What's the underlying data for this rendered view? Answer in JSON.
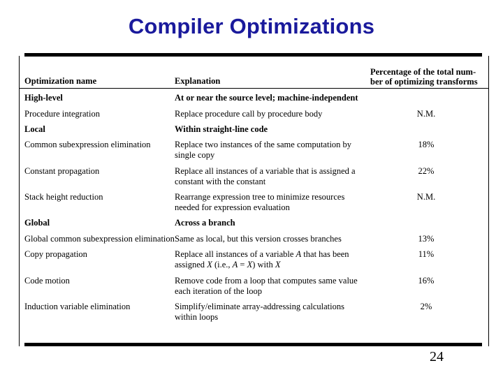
{
  "slide": {
    "title": "Compiler Optimizations",
    "number": "24",
    "title_color": "#1a1a9c"
  },
  "table": {
    "headers": {
      "name": "Optimization name",
      "explanation": "Explanation",
      "percentage_line1": "Percentage of the total num-",
      "percentage_line2": "ber of optimizing transforms"
    },
    "rows": [
      {
        "name": "High-level",
        "explanation": "At or near the source level; machine-independent",
        "percentage": "",
        "section": true
      },
      {
        "name": "Procedure integration",
        "explanation": "Replace procedure call by procedure body",
        "percentage": "N.M.",
        "section": false
      },
      {
        "name": "Local",
        "explanation": "Within straight-line code",
        "percentage": "",
        "section": true
      },
      {
        "name": "Common subexpression elimination",
        "explanation": "Replace two instances of the same computation by single copy",
        "percentage": "18%",
        "section": false
      },
      {
        "name": "Constant propagation",
        "explanation": "Replace all instances of a variable that is assigned a constant with the constant",
        "percentage": "22%",
        "section": false
      },
      {
        "name": "Stack height reduction",
        "explanation": "Rearrange expression tree to minimize resources needed for expression evaluation",
        "percentage": "N.M.",
        "section": false
      },
      {
        "name": "Global",
        "explanation": "Across a branch",
        "percentage": "",
        "section": true
      },
      {
        "name": "Global common subexpression elimination",
        "explanation": "Same as local, but this version crosses branches",
        "percentage": "13%",
        "section": false
      },
      {
        "name": "Copy propagation",
        "explanation": "Replace all instances of a variable A that has been assigned X (i.e., A = X) with X",
        "percentage": "11%",
        "section": false
      },
      {
        "name": "Code motion",
        "explanation": "Remove code from a loop that computes same value each iteration of the loop",
        "percentage": "16%",
        "section": false
      },
      {
        "name": "Induction variable elimination",
        "explanation": "Simplify/eliminate array-addressing calculations within loops",
        "percentage": "2%",
        "section": false
      }
    ]
  }
}
